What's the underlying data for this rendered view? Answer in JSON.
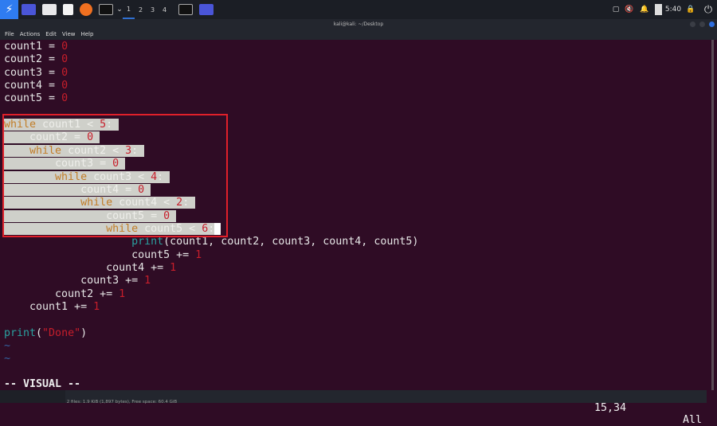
{
  "taskbar": {
    "workspaces": [
      "1",
      "2",
      "3",
      "4"
    ],
    "clock": "5:40"
  },
  "window": {
    "title": "kali@kali: ~/Desktop",
    "menu": [
      "File",
      "Actions",
      "Edit",
      "View",
      "Help"
    ]
  },
  "editor": {
    "lines": [
      [
        [
          "count1 = ",
          ""
        ],
        [
          "0",
          "num"
        ]
      ],
      [
        [
          "count2 = ",
          ""
        ],
        [
          "0",
          "num"
        ]
      ],
      [
        [
          "count3 = ",
          ""
        ],
        [
          "0",
          "num"
        ]
      ],
      [
        [
          "count4 = ",
          ""
        ],
        [
          "0",
          "num"
        ]
      ],
      [
        [
          "count5 = ",
          ""
        ],
        [
          "0",
          "num"
        ]
      ],
      [],
      [
        [
          "while",
          "kw"
        ],
        [
          " count1 < ",
          ""
        ],
        [
          "5",
          "num"
        ],
        [
          ": ",
          ""
        ]
      ],
      [
        [
          "    count2 = ",
          ""
        ],
        [
          "0",
          "num"
        ],
        [
          " ",
          ""
        ]
      ],
      [
        [
          "    ",
          ""
        ],
        [
          "while",
          "kw"
        ],
        [
          " count2 < ",
          ""
        ],
        [
          "3",
          "num"
        ],
        [
          ": ",
          ""
        ]
      ],
      [
        [
          "        count3 = ",
          ""
        ],
        [
          "0",
          "num"
        ],
        [
          " ",
          ""
        ]
      ],
      [
        [
          "        ",
          ""
        ],
        [
          "while",
          "kw"
        ],
        [
          " count3 < ",
          ""
        ],
        [
          "4",
          "num"
        ],
        [
          ": ",
          ""
        ]
      ],
      [
        [
          "            count4 = ",
          ""
        ],
        [
          "0",
          "num"
        ],
        [
          " ",
          ""
        ]
      ],
      [
        [
          "            ",
          ""
        ],
        [
          "while",
          "kw"
        ],
        [
          " count4 < ",
          ""
        ],
        [
          "2",
          "num"
        ],
        [
          ": ",
          ""
        ]
      ],
      [
        [
          "                count5 = ",
          ""
        ],
        [
          "0",
          "num"
        ],
        [
          " ",
          ""
        ]
      ],
      [
        [
          "                ",
          ""
        ],
        [
          "while",
          "kw"
        ],
        [
          " count5 < ",
          ""
        ],
        [
          "6",
          "num"
        ],
        [
          ":",
          ""
        ]
      ],
      [
        [
          "                    ",
          ""
        ],
        [
          "print",
          "fn"
        ],
        [
          "(count1, count2, count3, count4, count5)",
          ""
        ]
      ],
      [
        [
          "                    count5 += ",
          ""
        ],
        [
          "1",
          "num"
        ]
      ],
      [
        [
          "                count4 += ",
          ""
        ],
        [
          "1",
          "num"
        ]
      ],
      [
        [
          "            count3 += ",
          ""
        ],
        [
          "1",
          "num"
        ]
      ],
      [
        [
          "        count2 += ",
          ""
        ],
        [
          "1",
          "num"
        ]
      ],
      [
        [
          "    count1 += ",
          ""
        ],
        [
          "1",
          "num"
        ]
      ],
      [],
      [
        [
          "print",
          "fn"
        ],
        [
          "(",
          ""
        ],
        [
          "\"Done\"",
          "str"
        ],
        [
          ")",
          ""
        ]
      ],
      [
        [
          "~",
          "tilde"
        ]
      ],
      [
        [
          "~",
          "tilde"
        ]
      ]
    ],
    "selected_rows": [
      6,
      7,
      8,
      9,
      10,
      11,
      12,
      13,
      14
    ],
    "mode": "-- VISUAL --",
    "selection_count": "9",
    "position": "15,34",
    "scroll": "All"
  },
  "footer": {
    "status": "2 files: 1.9 KiB (1,897 bytes), Free space: 60.4 GiB"
  }
}
